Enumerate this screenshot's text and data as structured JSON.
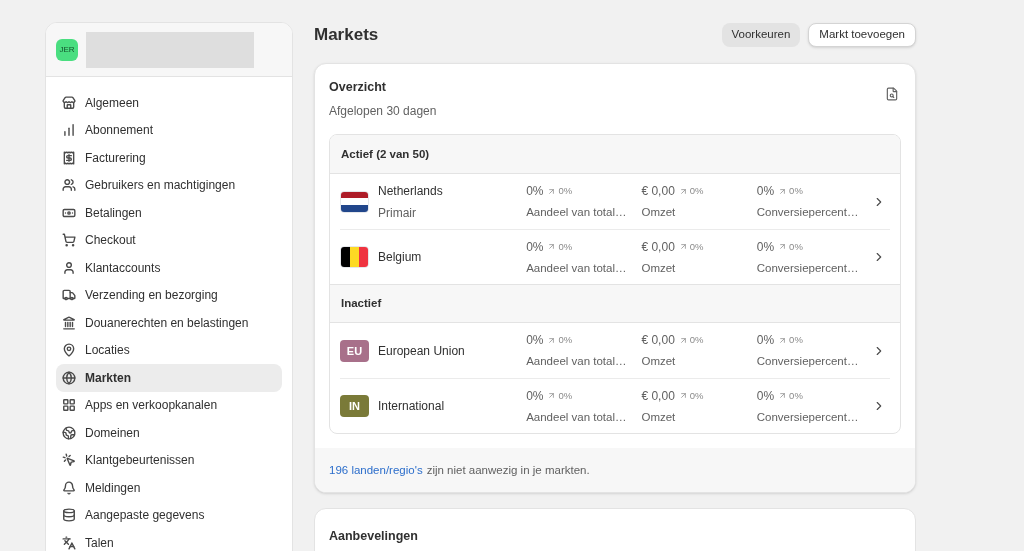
{
  "sidebar": {
    "store": {
      "avatar": "JER"
    },
    "items": [
      {
        "label": "Algemeen",
        "selected": false
      },
      {
        "label": "Abonnement",
        "selected": false
      },
      {
        "label": "Facturering",
        "selected": false
      },
      {
        "label": "Gebruikers en machtigingen",
        "selected": false
      },
      {
        "label": "Betalingen",
        "selected": false
      },
      {
        "label": "Checkout",
        "selected": false
      },
      {
        "label": "Klantaccounts",
        "selected": false
      },
      {
        "label": "Verzending en bezorging",
        "selected": false
      },
      {
        "label": "Douanerechten en belastingen",
        "selected": false
      },
      {
        "label": "Locaties",
        "selected": false
      },
      {
        "label": "Markten",
        "selected": true
      },
      {
        "label": "Apps en verkoopkanalen",
        "selected": false
      },
      {
        "label": "Domeinen",
        "selected": false
      },
      {
        "label": "Klantgebeurtenissen",
        "selected": false
      },
      {
        "label": "Meldingen",
        "selected": false
      },
      {
        "label": "Aangepaste gegevens",
        "selected": false
      },
      {
        "label": "Talen",
        "selected": false
      }
    ]
  },
  "page": {
    "title": "Markets",
    "buttons": [
      {
        "label": "Voorkeuren",
        "kind": "secondary"
      },
      {
        "label": "Markt toevoegen",
        "kind": "primary"
      }
    ]
  },
  "overview": {
    "title": "Overzicht",
    "subtitle": "Afgelopen 30 dagen",
    "groups": [
      {
        "heading": "Actief (2 van 50)",
        "markets": [
          {
            "name": "Netherlands",
            "note": "Primair",
            "icon": {
              "kind": "hflag",
              "stripes": [
                {
                  "color": "#ae1c28"
                },
                {
                  "color": "#ffffff"
                },
                {
                  "color": "#21468b"
                }
              ]
            },
            "metrics": [
              {
                "value": "0%",
                "change": "0%",
                "label": "Aandeel van total…"
              },
              {
                "value": "€ 0,00",
                "change": "0%",
                "label": "Omzet"
              },
              {
                "value": "0%",
                "change": "0%",
                "label": "Conversiepercent…"
              }
            ]
          },
          {
            "name": "Belgium",
            "icon": {
              "kind": "vflag",
              "stripes": [
                {
                  "color": "#000000"
                },
                {
                  "color": "#fdda24"
                },
                {
                  "color": "#ef3340"
                }
              ]
            },
            "metrics": [
              {
                "value": "0%",
                "change": "0%",
                "label": "Aandeel van total…"
              },
              {
                "value": "€ 0,00",
                "change": "0%",
                "label": "Omzet"
              },
              {
                "value": "0%",
                "change": "0%",
                "label": "Conversiepercent…"
              }
            ]
          }
        ]
      },
      {
        "heading": "Inactief",
        "markets": [
          {
            "name": "European Union",
            "icon": {
              "kind": "badge",
              "text": "EU",
              "color": "#a8708a"
            },
            "metrics": [
              {
                "value": "0%",
                "change": "0%",
                "label": "Aandeel van total…"
              },
              {
                "value": "€ 0,00",
                "change": "0%",
                "label": "Omzet"
              },
              {
                "value": "0%",
                "change": "0%",
                "label": "Conversiepercent…"
              }
            ]
          },
          {
            "name": "International",
            "icon": {
              "kind": "badge",
              "text": "IN",
              "color": "#7a7a38"
            },
            "metrics": [
              {
                "value": "0%",
                "change": "0%",
                "label": "Aandeel van total…"
              },
              {
                "value": "€ 0,00",
                "change": "0%",
                "label": "Omzet"
              },
              {
                "value": "0%",
                "change": "0%",
                "label": "Conversiepercent…"
              }
            ]
          }
        ]
      }
    ],
    "footer": {
      "link": "196 landen/regio's",
      "text": "zijn niet aanwezig in je markten."
    }
  },
  "recommendations": {
    "title": "Aanbevelingen"
  }
}
